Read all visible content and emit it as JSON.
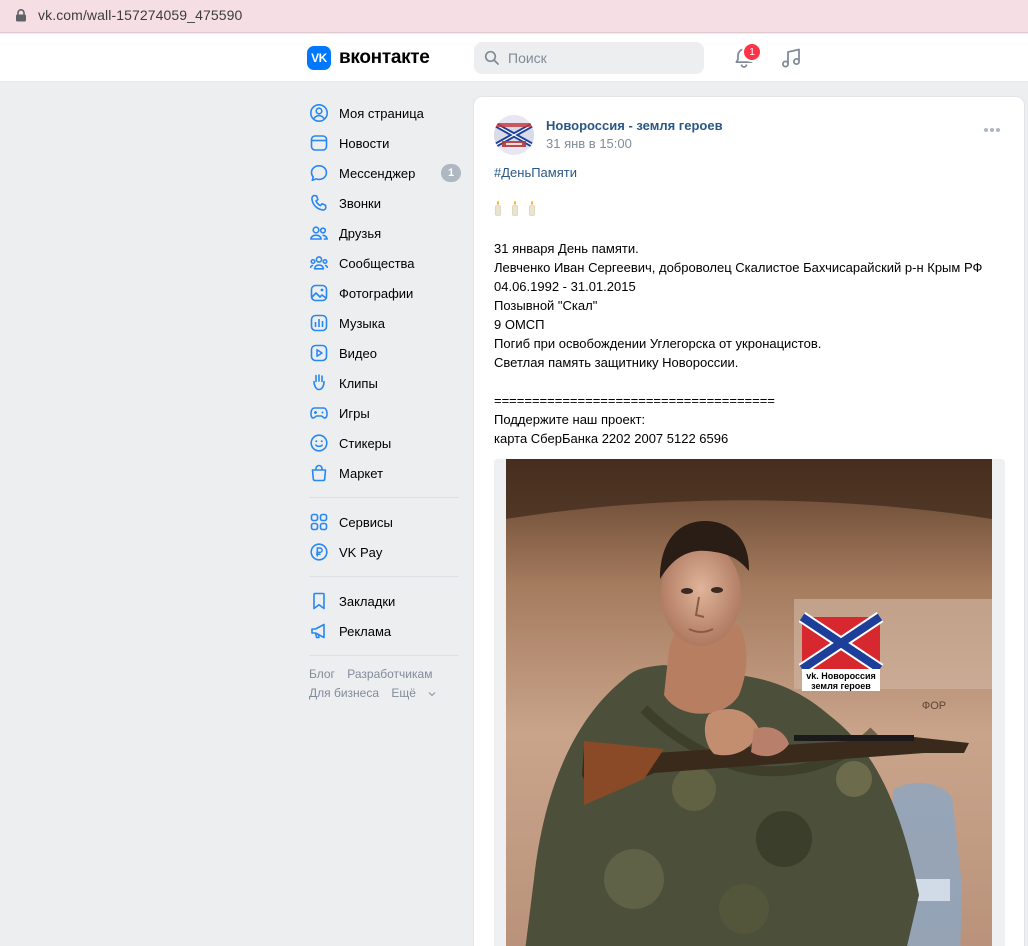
{
  "browser": {
    "url": "vk.com/wall-157274059_475590"
  },
  "header": {
    "logo_text": "вконтакте",
    "logo_mark": "VK",
    "search_placeholder": "Поиск",
    "notifications_count": "1",
    "icons": [
      "search-icon",
      "bell-icon",
      "music-icon"
    ]
  },
  "sidebar": {
    "items": [
      {
        "label": "Моя страница",
        "icon": "user-circle-icon"
      },
      {
        "label": "Новости",
        "icon": "news-icon"
      },
      {
        "label": "Мессенджер",
        "icon": "message-icon",
        "badge": "1"
      },
      {
        "label": "Звонки",
        "icon": "phone-icon"
      },
      {
        "label": "Друзья",
        "icon": "friends-icon"
      },
      {
        "label": "Сообщества",
        "icon": "communities-icon"
      },
      {
        "label": "Фотографии",
        "icon": "photo-icon"
      },
      {
        "label": "Музыка",
        "icon": "music-icon"
      },
      {
        "label": "Видео",
        "icon": "video-icon"
      },
      {
        "label": "Клипы",
        "icon": "clips-icon"
      },
      {
        "label": "Игры",
        "icon": "gamepad-icon"
      },
      {
        "label": "Стикеры",
        "icon": "smile-icon"
      },
      {
        "label": "Маркет",
        "icon": "bag-icon"
      }
    ],
    "items2": [
      {
        "label": "Сервисы",
        "icon": "services-icon"
      },
      {
        "label": "VK Pay",
        "icon": "ruble-icon"
      }
    ],
    "items3": [
      {
        "label": "Закладки",
        "icon": "bookmark-icon"
      },
      {
        "label": "Реклама",
        "icon": "megaphone-icon"
      }
    ],
    "footer": {
      "blog": "Блог",
      "developers": "Разработчикам",
      "business": "Для бизнеса",
      "more": "Ещё"
    }
  },
  "post": {
    "author": "Новороссия - земля героев",
    "date": "31 янв в 15:00",
    "hashtag": "#ДеньПамяти",
    "lines": [
      "31 января День памяти.",
      "Левченко Иван Сергеевич, доброволец Скалистое Бахчисарайский р-н Крым РФ",
      "04.06.1992 - 31.01.2015",
      "Позывной \"Скал\"",
      "9 ОМСП",
      "Погиб при освобождении Углегорска от укронацистов.",
      "Светлая память защитнику Новороссии."
    ],
    "separator": "=====================================",
    "support_lines": [
      "Поддержите наш проект:",
      "карта СберБанка 2202 2007 5122 6596"
    ],
    "photo_watermark_line1": "vk. Новороссия",
    "photo_watermark_line2": "земля героев",
    "photo_wall_text": "ФОР"
  },
  "colors": {
    "accent": "#0077ff",
    "link": "#2a5885",
    "muted": "#818c99",
    "badge_red": "#ff3347"
  }
}
